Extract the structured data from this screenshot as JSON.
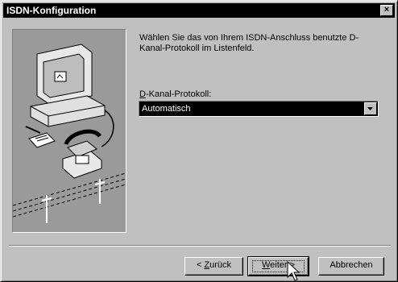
{
  "window": {
    "title": "ISDN-Konfiguration",
    "close_glyph": "×"
  },
  "instruction": "Wählen Sie das von Ihrem ISDN-Anschluss benutzte D-Kanal-Protokoll im Listenfeld.",
  "protocol": {
    "label_mnemonic": "D",
    "label_rest": "-Kanal-Protokoll:",
    "selected_value": "Automatisch"
  },
  "buttons": {
    "back": {
      "prefix": "< ",
      "mnemonic": "Z",
      "rest": "urück"
    },
    "next": {
      "mnemonic": "W",
      "rest": "eiter >"
    },
    "cancel": "Abbrechen"
  },
  "icons": {
    "close": "close-icon",
    "dropdown": "chevron-down-icon",
    "cursor": "mouse-pointer-icon",
    "illustration": "computer-telephone-illustration"
  },
  "colors": {
    "dialog_face": "#c0c0c0",
    "titlebar": "#000000",
    "selection": "#000000",
    "illustration_bg": "#9a9a9a"
  }
}
